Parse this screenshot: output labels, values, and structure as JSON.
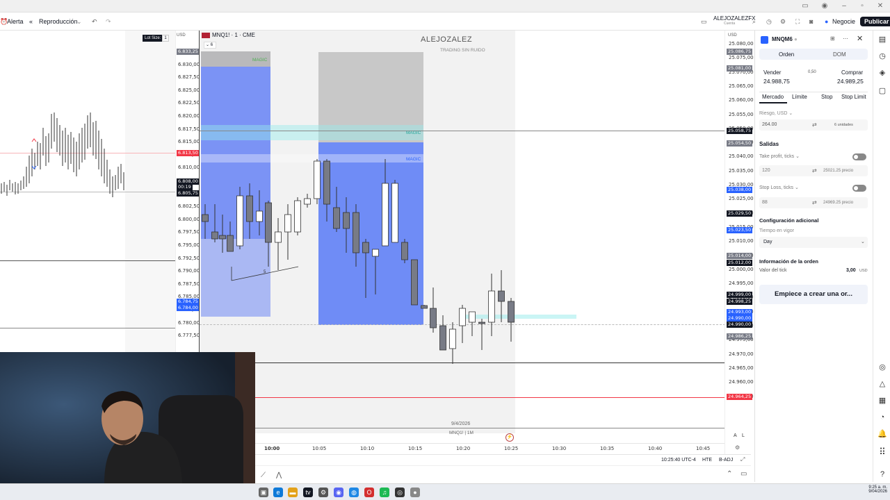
{
  "toolbar": {
    "alert_label": "Alerta",
    "replay_label": "Reproducción",
    "account_name": "ALEJOZALEZFX",
    "account_sub": "Cuenta",
    "trade_label": "Negocie",
    "publish_label": "Publicar"
  },
  "left_chart": {
    "lot_label": "Lot Size:",
    "lot_value": "1",
    "currency": "USD",
    "price_labels": [
      "6.833,25",
      "6.830,00",
      "6.827,50",
      "6.825,00",
      "6.822,50",
      "6.820,00",
      "6.817,50",
      "6.815,00",
      "6.812,50",
      "6.810,00",
      "6.807,50",
      "6.805,00",
      "6.802,50",
      "6.800,00",
      "6.797,50",
      "6.795,00",
      "6.792,50",
      "6.790,00",
      "6.787,50",
      "6.785,00",
      "6.782,50",
      "6.780,00",
      "6.777,50"
    ],
    "badge_red": "6.813,50",
    "badge_black_price": "6.808,00",
    "badge_black_timer": "00:19",
    "badge_black2": "6.805,75",
    "badge_blue1": "6.784,75",
    "badge_blue2": "6.784,00",
    "badge_grey": "6.833,25"
  },
  "main_chart": {
    "symbol": "MNQ1! · 1 · CME",
    "timeframe_badge": "6",
    "watermark_title": "ALEJOZALEZ",
    "watermark_sub": "TRADING SIN RUIDO",
    "zone_label_1": "MAGIC",
    "zone_label_2": "MAGIC",
    "zone_label_3": "MAGIC",
    "small_marker": "5",
    "date_label": "9/4/2026",
    "bottom_symbol": "MNQ1! | 1M",
    "currency": "USD",
    "price_labels": [
      "25.080,00",
      "25.075,00",
      "25.070,00",
      "25.065,00",
      "25.060,00",
      "25.055,00",
      "25.050,00",
      "25.045,00",
      "25.040,00",
      "25.035,00",
      "25.030,00",
      "25.025,00",
      "25.020,00",
      "25.015,00",
      "25.010,00",
      "25.005,00",
      "25.000,00",
      "24.995,00",
      "24.990,00",
      "24.985,00",
      "24.980,00",
      "24.975,00",
      "24.970,00",
      "24.965,00",
      "24.960,00",
      "24.955,00"
    ],
    "badges": [
      {
        "text": "25.086,75",
        "color": "#787b86"
      },
      {
        "text": "25.081,00",
        "color": "#787b86"
      },
      {
        "text": "25.058,75",
        "color": "#131722"
      },
      {
        "text": "25.054,50",
        "color": "#787b86"
      },
      {
        "text": "25.038,00",
        "color": "#2962ff"
      },
      {
        "text": "25.029,50",
        "color": "#131722"
      },
      {
        "text": "25.023,50",
        "color": "#2962ff"
      },
      {
        "text": "25.014,00",
        "color": "#787b86"
      },
      {
        "text": "25.012,00",
        "color": "#131722"
      },
      {
        "text": "24.999,00",
        "color": "#131722"
      },
      {
        "text": "24.998,25",
        "color": "#131722"
      },
      {
        "text": "24.993,00",
        "color": "#2962ff"
      },
      {
        "text": "24.990,00",
        "color": "#2962ff"
      },
      {
        "text": "24.990,00",
        "color": "#131722"
      },
      {
        "text": "24.986,25",
        "color": "#787b86"
      },
      {
        "text": "24.964,25",
        "color": "#f23645"
      }
    ],
    "time_labels": [
      "10:00",
      "10:05",
      "10:10",
      "10:15",
      "10:20",
      "10:25",
      "10:30",
      "10:35",
      "10:40",
      "10:45"
    ],
    "clock_text": "10:25:40 UTC-4",
    "hte_label": "HTE",
    "badj_label": "B-ADJ",
    "auto_a": "A",
    "auto_l": "L"
  },
  "order_panel": {
    "symbol": "MNQM6",
    "tab_order": "Orden",
    "tab_dom": "DOM",
    "sell_label": "Vender",
    "sell_price": "24.988,75",
    "spread": "0,50",
    "buy_label": "Comprar",
    "buy_price": "24.989,25",
    "type_market": "Mercado",
    "type_limit": "Límite",
    "type_stop": "Stop",
    "type_stoplimit": "Stop Limit",
    "risk_label": "Riesgo, USD",
    "risk_value": "264.00",
    "units": "6 unidades",
    "exits_label": "Salidas",
    "tp_label": "Take profit, ticks",
    "tp_value": "120",
    "tp_price": "25021.25 precio",
    "sl_label": "Stop Loss, ticks",
    "sl_value": "88",
    "sl_price": "24969.25 precio",
    "extra_config": "Configuración adicional",
    "tif_label": "Tiempo en vigor",
    "tif_value": "Day",
    "order_info": "Información de la orden",
    "tick_value_label": "Valor del tick",
    "tick_value": "3,00",
    "tick_currency": "USD",
    "cta": "Empiece a crear una or..."
  },
  "taskbar": {
    "time": "9:25 a. m.",
    "date": "9/04/2026"
  },
  "colors": {
    "blue_zone": "#7b93f5",
    "grey_zone": "#c6c6c6",
    "bull": "#ffffff",
    "bear": "#787b86"
  }
}
